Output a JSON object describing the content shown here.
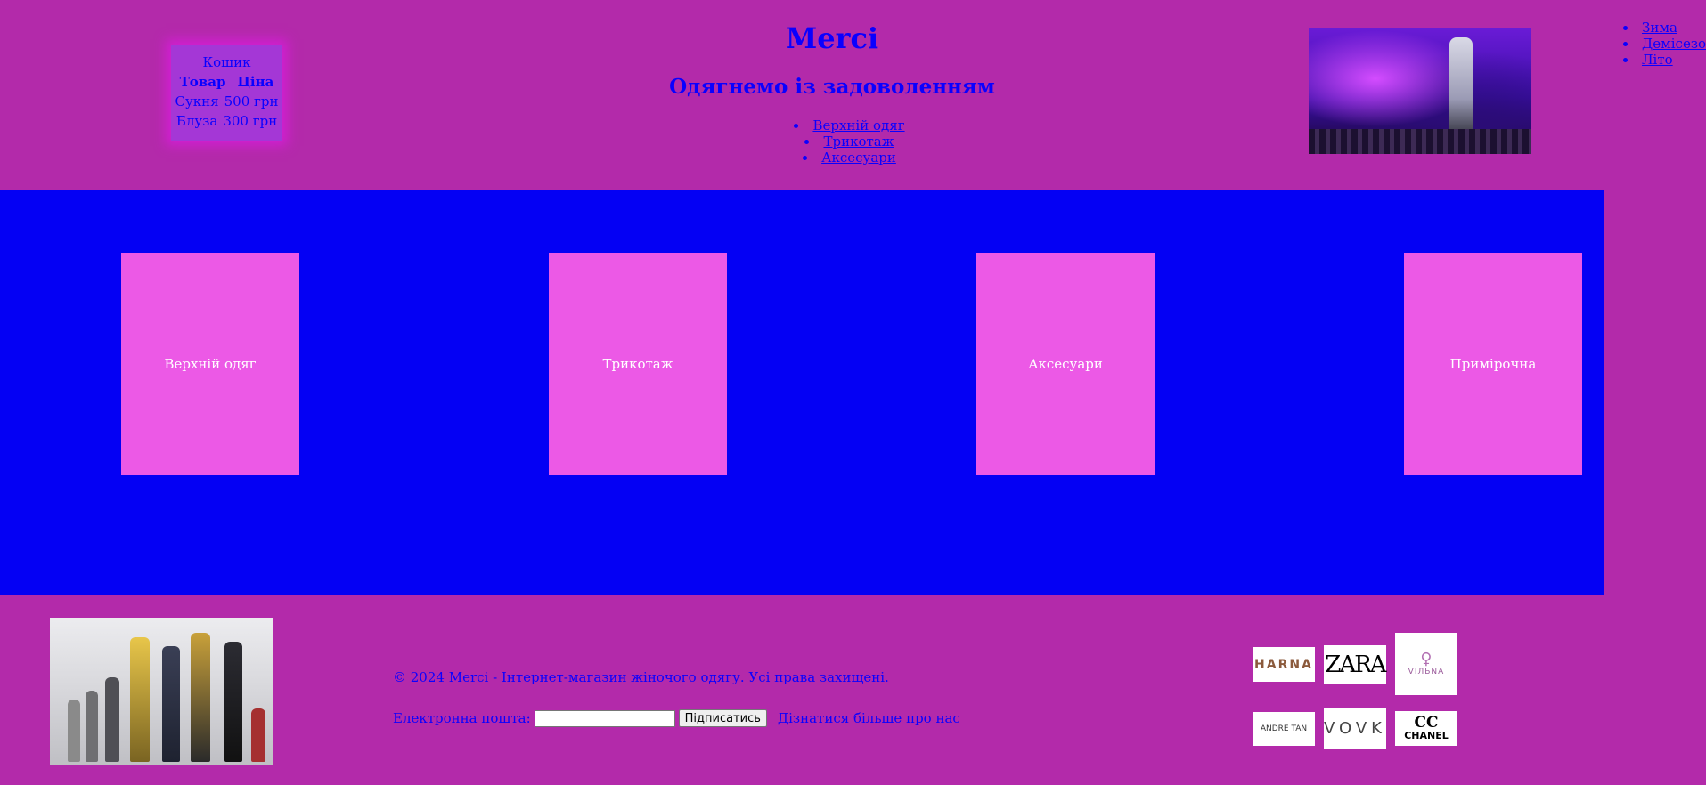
{
  "cart": {
    "title": "Кошик",
    "col_product": "Товар",
    "col_price": "Ціна",
    "items": [
      {
        "name": "Сукня",
        "price": "500 грн"
      },
      {
        "name": "Блуза",
        "price": "300 грн"
      }
    ]
  },
  "header": {
    "brand": "Merci",
    "slogan": "Одягнемо із задоволенням",
    "categories": [
      "Верхній одяг",
      "Трикотаж",
      "Аксесуари"
    ]
  },
  "season_nav": [
    "Зима",
    "Демісезон",
    "Літо"
  ],
  "main": {
    "cards": [
      "Верхній одяг",
      "Трикотаж",
      "Аксесуари",
      "Примірочна"
    ]
  },
  "footer": {
    "copyright": "© 2024 Merci - Інтернет-магазин жіночого одягу. Усі права захищені.",
    "email_label": "Електронна пошта:",
    "email_value": "",
    "subscribe_label": "Підписатись",
    "about_link": "Дізнатися більше про нас"
  },
  "brands": {
    "harna": "HARNA",
    "zara": "ZARA",
    "vilna": "VIЛЬNA",
    "andre_tan": "ANDRE TAN",
    "vovk": "VOVK",
    "chanel": "CHANEL"
  },
  "colors": {
    "background": "#b32aaa",
    "main_section": "#0400f4",
    "card": "#ec59e6",
    "text": "#0a00ff"
  }
}
